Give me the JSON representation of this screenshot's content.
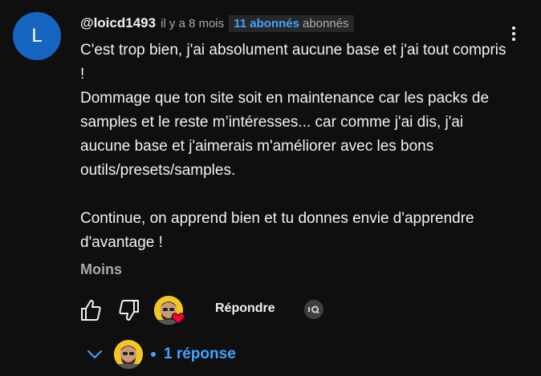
{
  "comment": {
    "avatar_letter": "L",
    "author": "@loicd1493",
    "time": "il y a 8 mois",
    "badge_count": "11 abonnés",
    "badge_label": "abonnés",
    "paragraphs": [
      "C'est trop bien, j'ai absolument aucune base et j'ai tout compris !",
      "Dommage que ton site soit en maintenance car les packs de samples et le reste m’intéresses... car comme j'ai dis, j'ai aucune base et j'aimerais m'améliorer avec les bons outils/presets/samples.",
      "Continue, on apprend bien et tu donnes envie d'apprendre d'avantage !"
    ],
    "less_label": "Moins",
    "reply_label": "Répondre",
    "replies_label": "1 réponse"
  },
  "colors": {
    "background": "#0f0f0f",
    "avatar": "#1565c0",
    "accent": "#3ea6ff",
    "heart": "#ff0033",
    "muted": "#aaaaaa"
  },
  "icons": [
    "more-vert-icon",
    "thumb-up-icon",
    "thumb-down-icon",
    "heart-icon",
    "iq-icon",
    "chevron-down-icon"
  ]
}
